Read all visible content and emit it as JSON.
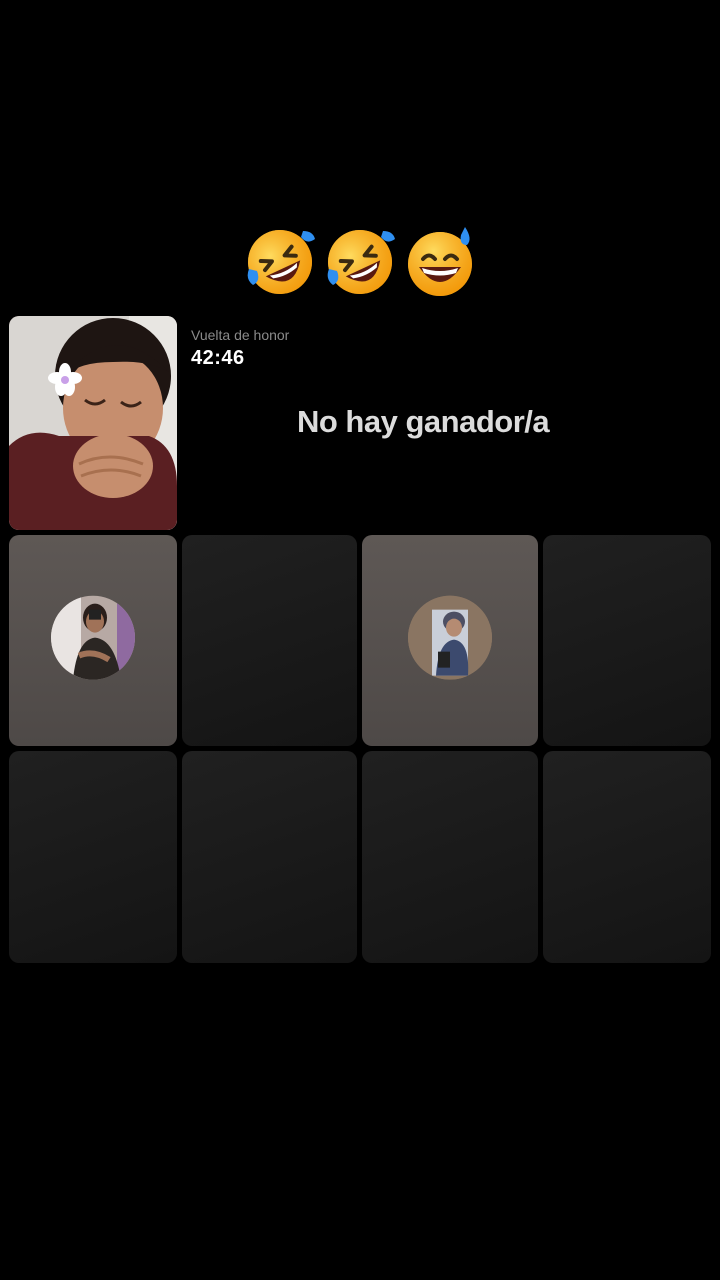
{
  "reactions": {
    "emojis": [
      "rofl-emoji",
      "rofl-emoji",
      "grinning-sweat-emoji"
    ]
  },
  "host": {
    "name_hidden": true
  },
  "battle": {
    "round_label": "Vuelta de honor",
    "timer": "42:46",
    "result": "No hay ganador/a"
  },
  "slots": [
    {
      "state": "guest-avatar"
    },
    {
      "state": "empty"
    },
    {
      "state": "guest-avatar"
    },
    {
      "state": "empty"
    },
    {
      "state": "empty"
    },
    {
      "state": "empty"
    },
    {
      "state": "empty"
    },
    {
      "state": "empty"
    }
  ],
  "colors": {
    "background": "#000000",
    "active_slot": "#565150",
    "empty_slot": "#1a1a1a",
    "result_text": "#dcdcdc",
    "label_text": "#8a8a8a"
  }
}
